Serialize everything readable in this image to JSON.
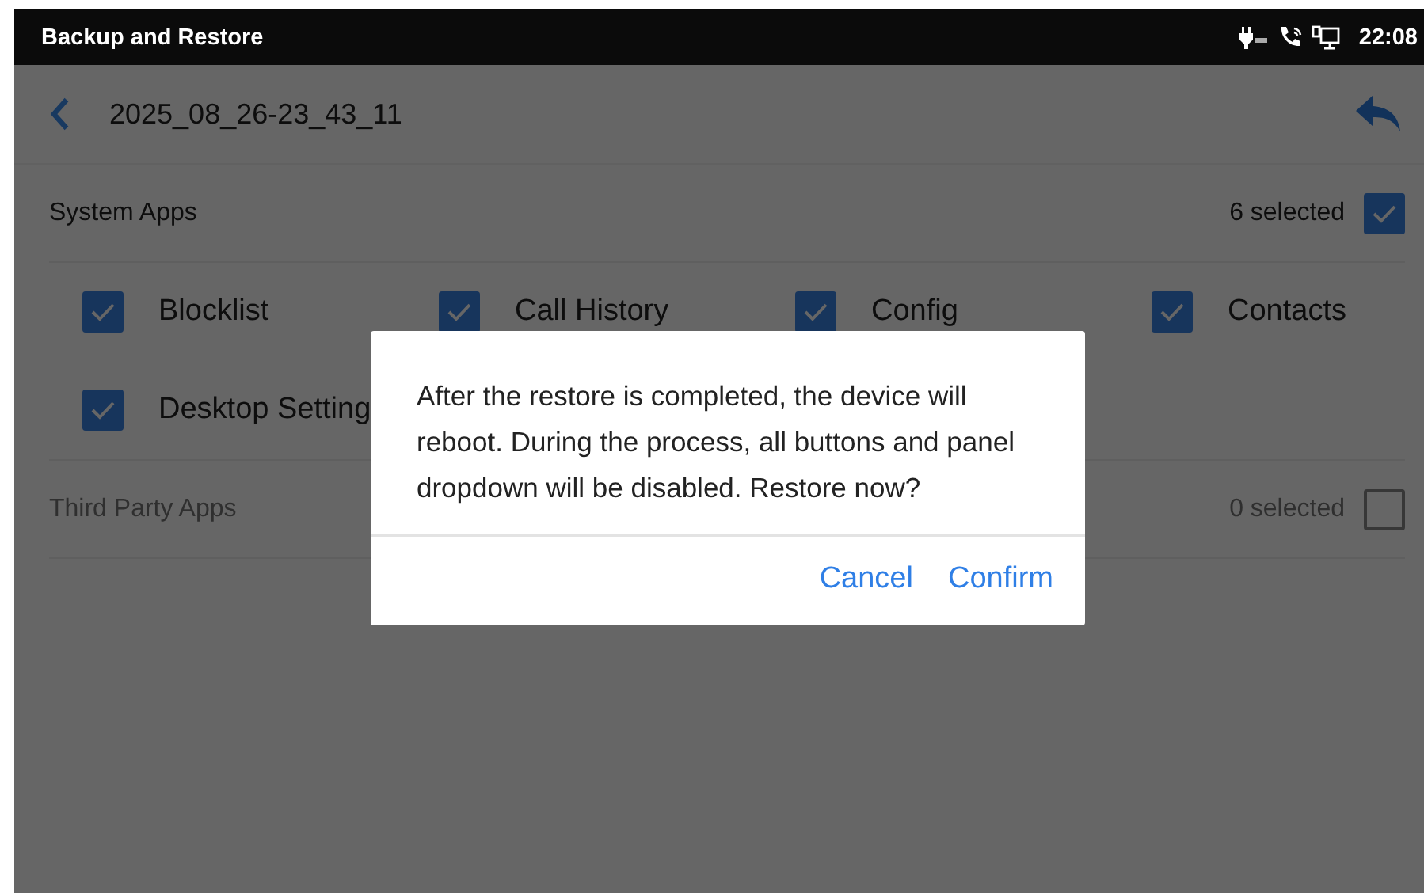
{
  "status_bar": {
    "title": "Backup and Restore",
    "time": "22:08"
  },
  "header": {
    "title": "2025_08_26-23_43_11"
  },
  "sections": [
    {
      "title": "System Apps",
      "count": "6 selected",
      "checked": true,
      "items": [
        {
          "label": "Blocklist",
          "checked": true
        },
        {
          "label": "Call History",
          "checked": true
        },
        {
          "label": "Config",
          "checked": true
        },
        {
          "label": "Contacts",
          "checked": true
        },
        {
          "label": "Desktop Setting",
          "checked": true
        }
      ]
    },
    {
      "title": "Third Party Apps",
      "count": "0 selected",
      "checked": false
    }
  ],
  "dialog": {
    "message": "After the restore is completed, the device will reboot. During the process, all buttons and panel dropdown will be disabled. Restore now?",
    "buttons": [
      "Cancel",
      "Confirm"
    ]
  }
}
